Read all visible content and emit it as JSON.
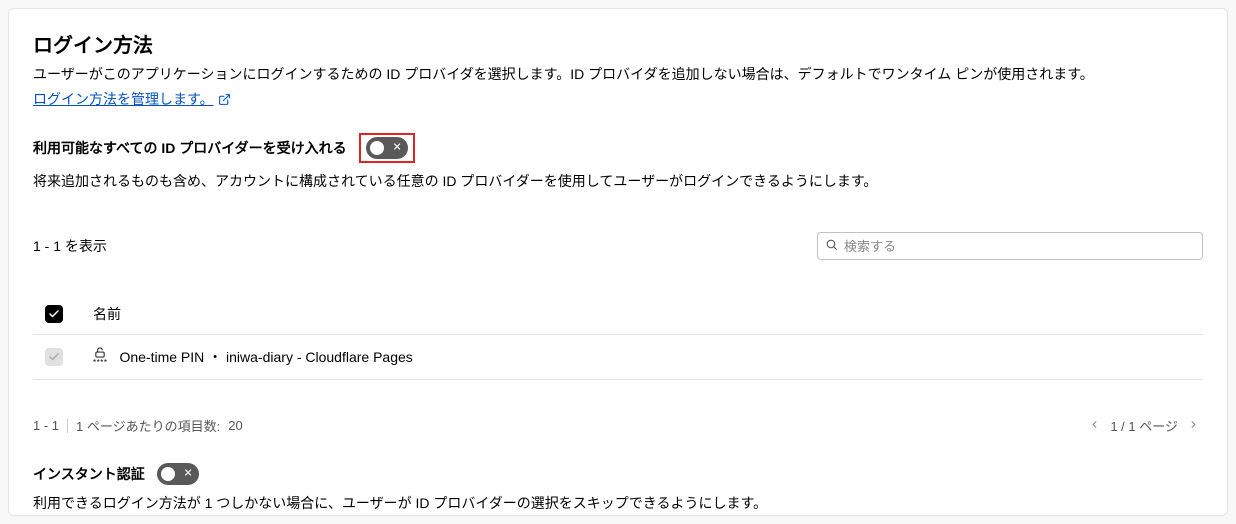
{
  "section": {
    "title": "ログイン方法",
    "description": "ユーザーがこのアプリケーションにログインするための ID プロバイダを選択します。ID プロバイダを追加しない場合は、デフォルトでワンタイム ピンが使用されます。",
    "manage_link_text": "ログイン方法を管理します。"
  },
  "accept_all": {
    "label": "利用可能なすべての ID プロバイダーを受け入れる",
    "description": "将来追加されるものも含め、アカウントに構成されている任意の ID プロバイダーを使用してユーザーがログインできるようにします。",
    "enabled": false
  },
  "listing": {
    "count_label": "1 - 1 を表示",
    "search_placeholder": "検索する",
    "header_name": "名前",
    "rows": [
      {
        "text": "One-time PIN ・ iniwa-diary - Cloudflare Pages",
        "icon": "pin-icon"
      }
    ]
  },
  "pager": {
    "range": "1 - 1",
    "per_page_label": "1 ページあたりの項目数:",
    "per_page_value": "20",
    "page_label": "1 / 1 ページ"
  },
  "instant": {
    "label": "インスタント認証",
    "description": "利用できるログイン方法が 1 つしかない場合に、ユーザーが ID プロバイダーの選択をスキップできるようにします。",
    "enabled": false
  }
}
